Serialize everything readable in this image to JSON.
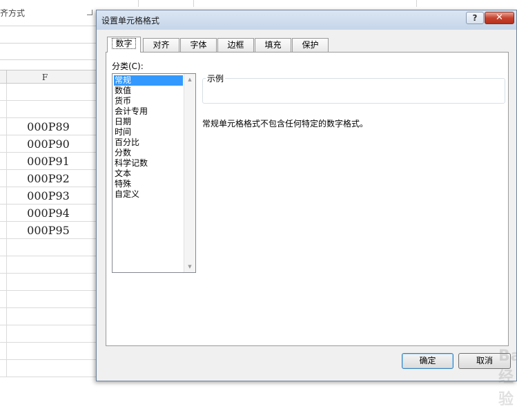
{
  "sheet": {
    "ribbon_group_label": "齐方式",
    "column_header": "F",
    "cells": [
      "",
      "",
      "000P89",
      "000P90",
      "000P91",
      "000P92",
      "000P93",
      "000P94",
      "000P95",
      "",
      "",
      "",
      "",
      "",
      "",
      "",
      ""
    ]
  },
  "dialog": {
    "title": "设置单元格格式",
    "help_label": "?",
    "close_label": "✕",
    "tabs": [
      "数字",
      "对齐",
      "字体",
      "边框",
      "填充",
      "保护"
    ],
    "active_tab": "数字",
    "category_label": "分类(C):",
    "categories": [
      "常规",
      "数值",
      "货币",
      "会计专用",
      "日期",
      "时间",
      "百分比",
      "分数",
      "科学记数",
      "文本",
      "特殊",
      "自定义"
    ],
    "selected_category": "常规",
    "sample_legend": "示例",
    "description": "常规单元格格式不包含任何特定的数字格式。",
    "ok_label": "确定",
    "cancel_label": "取消",
    "watermark": "Bai经验"
  }
}
